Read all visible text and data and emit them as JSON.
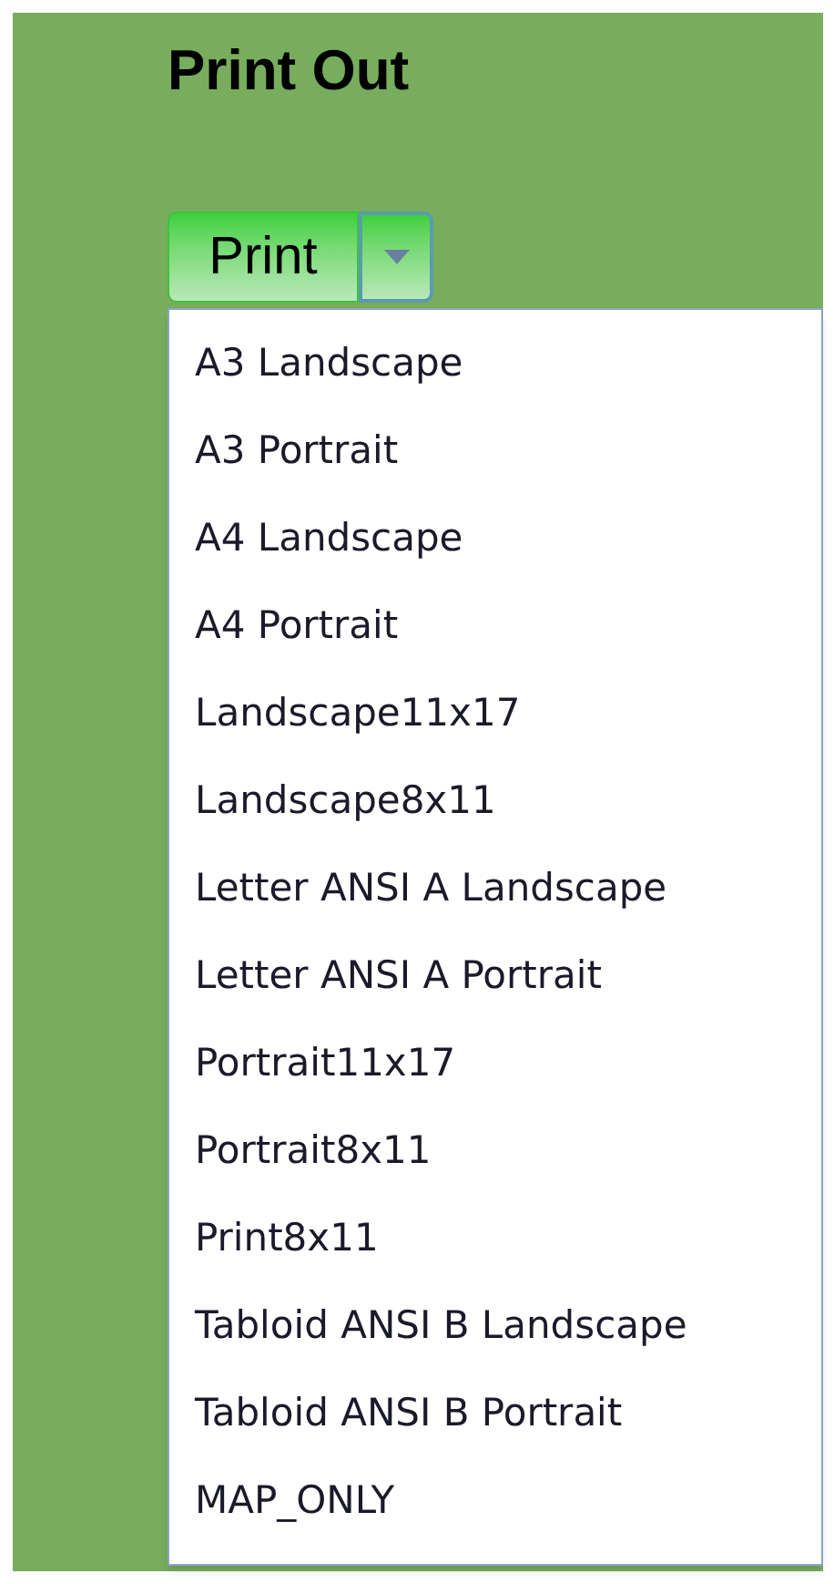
{
  "title": "Print Out",
  "print_button": {
    "label": "Print",
    "expanded": true
  },
  "menu_items": [
    {
      "label": "A3 Landscape"
    },
    {
      "label": "A3 Portrait"
    },
    {
      "label": "A4 Landscape"
    },
    {
      "label": "A4 Portrait"
    },
    {
      "label": "Landscape11x17"
    },
    {
      "label": "Landscape8x11"
    },
    {
      "label": "Letter ANSI A Landscape"
    },
    {
      "label": "Letter ANSI A Portrait"
    },
    {
      "label": "Portrait11x17"
    },
    {
      "label": "Portrait8x11"
    },
    {
      "label": "Print8x11"
    },
    {
      "label": "Tabloid ANSI B Landscape"
    },
    {
      "label": "Tabloid ANSI B Portrait"
    },
    {
      "label": "MAP_ONLY"
    }
  ]
}
